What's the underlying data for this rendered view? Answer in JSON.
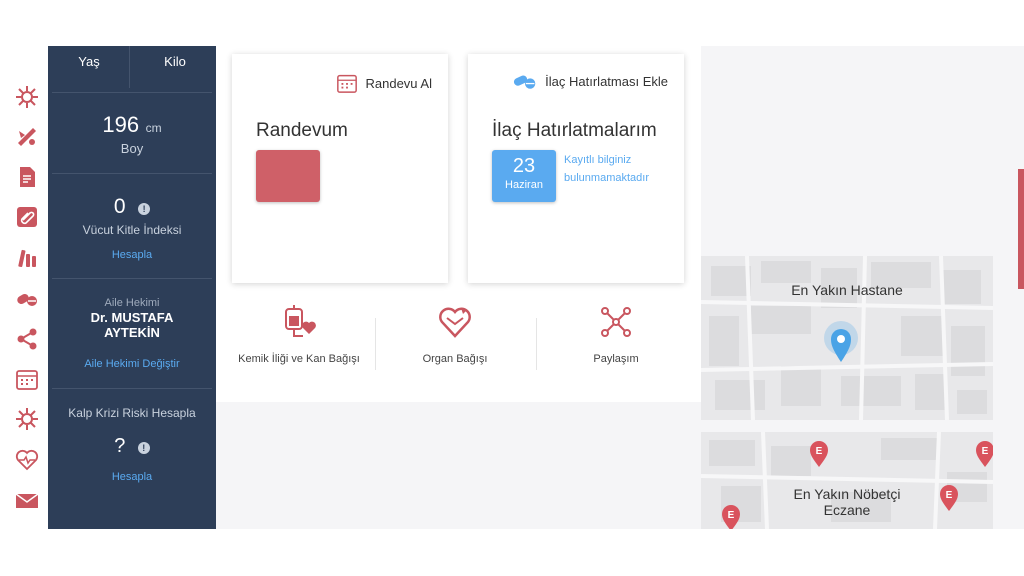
{
  "profile": {
    "age_label": "Yaş",
    "weight_label": "Kilo",
    "height_value": "196",
    "height_unit": "cm",
    "height_label": "Boy",
    "bmi_value": "0",
    "bmi_label": "Vücut Kitle İndeksi",
    "bmi_action": "Hesapla",
    "doctor_caption": "Aile Hekimi",
    "doctor_name_line1": "Dr. MUSTAFA",
    "doctor_name_line2": "AYTEKİN",
    "doctor_action": "Aile Hekimi Değiştir",
    "heart_risk_label": "Kalp Krizi Riski Hesapla",
    "heart_risk_value": "?",
    "heart_risk_action": "Hesapla"
  },
  "appointment_card": {
    "action_label": "Randevu Al",
    "title": "Randevum",
    "accent_color": "#cf6068"
  },
  "medication_card": {
    "action_label": "İlaç Hatırlatması Ekle",
    "title": "İlaç Hatırlatmalarım",
    "date_day": "23",
    "date_month": "Haziran",
    "date_color": "#5aaaf0",
    "empty_message_line1": "Kayıtlı bilginiz",
    "empty_message_line2": "bulunmamaktadır"
  },
  "quick_actions": [
    {
      "label": "Kemik İliği ve Kan Bağışı",
      "icon": "blood-bag-heart-icon"
    },
    {
      "label": "Organ Bağışı",
      "icon": "heart-arrows-icon"
    },
    {
      "label": "Paylaşım",
      "icon": "network-share-icon"
    }
  ],
  "maps": {
    "hospital_label": "En Yakın Hastane",
    "pharmacy_label_line1": "En Yakın Nöbetçi",
    "pharmacy_label_line2": "Eczane",
    "pin_blue": "#4aa3e6",
    "pin_red": "#d9535d",
    "pharmacy_marker_letter": "E"
  },
  "rail_icons": [
    "virus-icon",
    "pill-crossed-icon",
    "document-icon",
    "paperclip-icon",
    "vials-icon",
    "capsule-icon",
    "share-icon",
    "calendar-icon",
    "virus-icon",
    "heart-pulse-icon",
    "mail-icon"
  ],
  "brand_color": "#c9565f"
}
